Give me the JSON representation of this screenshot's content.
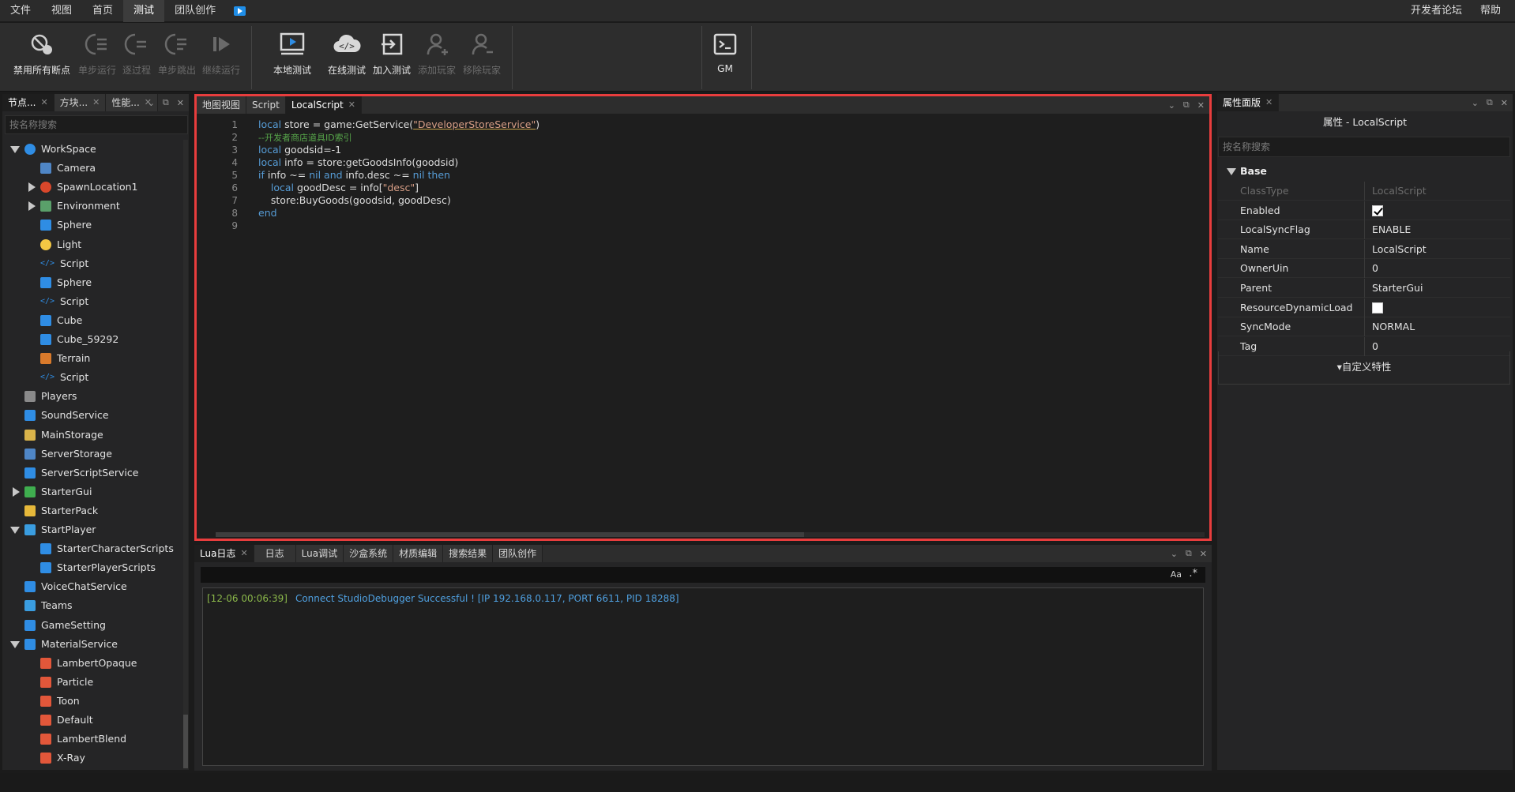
{
  "menu": {
    "items": [
      "文件",
      "视图",
      "首页",
      "测试",
      "团队创作"
    ],
    "active": "测试",
    "right": [
      "开发者论坛",
      "帮助"
    ]
  },
  "toolbar": {
    "disable_breakpoints": "禁用所有断点",
    "step_run": "单步运行",
    "step_over": "逐过程",
    "step_out": "单步跳出",
    "continue_run": "继续运行",
    "local_test": "本地测试",
    "online_test": "在线测试",
    "join_test": "加入测试",
    "add_player": "添加玩家",
    "remove_player": "移除玩家",
    "gm": "GM"
  },
  "explorer": {
    "tabs": [
      "节点...",
      "方块...",
      "性能..."
    ],
    "search_placeholder": "按名称搜索",
    "tree": [
      {
        "label": "WorkSpace",
        "depth": 0,
        "expand": "down",
        "color": "#2f8de4",
        "round": true
      },
      {
        "label": "Camera",
        "depth": 1,
        "expand": "",
        "color": "#4f86c6"
      },
      {
        "label": "SpawnLocation1",
        "depth": 1,
        "expand": "right",
        "color": "#d9472b",
        "round": true
      },
      {
        "label": "Environment",
        "depth": 1,
        "expand": "right",
        "color": "#5aa06a"
      },
      {
        "label": "Sphere",
        "depth": 1,
        "expand": "",
        "color": "#2f8de4"
      },
      {
        "label": "Light",
        "depth": 1,
        "expand": "",
        "color": "#f2c744",
        "round": true
      },
      {
        "label": "Script",
        "depth": 1,
        "expand": "",
        "color": "#2f8de4",
        "code": true
      },
      {
        "label": "Sphere",
        "depth": 1,
        "expand": "",
        "color": "#2f8de4"
      },
      {
        "label": "Script",
        "depth": 1,
        "expand": "",
        "color": "#2f8de4",
        "code": true
      },
      {
        "label": "Cube",
        "depth": 1,
        "expand": "",
        "color": "#2f8de4"
      },
      {
        "label": "Cube_59292",
        "depth": 1,
        "expand": "",
        "color": "#2f8de4"
      },
      {
        "label": "Terrain",
        "depth": 1,
        "expand": "",
        "color": "#d97a2b"
      },
      {
        "label": "Script",
        "depth": 1,
        "expand": "",
        "color": "#2f8de4",
        "code": true
      },
      {
        "label": "Players",
        "depth": 0,
        "expand": "",
        "color": "#8a8a8a"
      },
      {
        "label": "SoundService",
        "depth": 0,
        "expand": "",
        "color": "#2f8de4"
      },
      {
        "label": "MainStorage",
        "depth": 0,
        "expand": "",
        "color": "#d9b34a"
      },
      {
        "label": "ServerStorage",
        "depth": 0,
        "expand": "",
        "color": "#4f86c6"
      },
      {
        "label": "ServerScriptService",
        "depth": 0,
        "expand": "",
        "color": "#2f8de4"
      },
      {
        "label": "StarterGui",
        "depth": 0,
        "expand": "right",
        "color": "#3fae4f"
      },
      {
        "label": "StarterPack",
        "depth": 0,
        "expand": "",
        "color": "#e6b83a"
      },
      {
        "label": "StartPlayer",
        "depth": 0,
        "expand": "down",
        "color": "#3a9de0"
      },
      {
        "label": "StarterCharacterScripts",
        "depth": 1,
        "expand": "",
        "color": "#2f8de4"
      },
      {
        "label": "StarterPlayerScripts",
        "depth": 1,
        "expand": "",
        "color": "#2f8de4"
      },
      {
        "label": "VoiceChatService",
        "depth": 0,
        "expand": "",
        "color": "#2f8de4"
      },
      {
        "label": "Teams",
        "depth": 0,
        "expand": "",
        "color": "#3a9de0"
      },
      {
        "label": "GameSetting",
        "depth": 0,
        "expand": "",
        "color": "#2f8de4"
      },
      {
        "label": "MaterialService",
        "depth": 0,
        "expand": "down",
        "color": "#2f8de4"
      },
      {
        "label": "LambertOpaque",
        "depth": 1,
        "expand": "",
        "color": "#e2573a"
      },
      {
        "label": "Particle",
        "depth": 1,
        "expand": "",
        "color": "#e2573a"
      },
      {
        "label": "Toon",
        "depth": 1,
        "expand": "",
        "color": "#e2573a"
      },
      {
        "label": "Default",
        "depth": 1,
        "expand": "",
        "color": "#e2573a"
      },
      {
        "label": "LambertBlend",
        "depth": 1,
        "expand": "",
        "color": "#e2573a"
      },
      {
        "label": "X-Ray",
        "depth": 1,
        "expand": "",
        "color": "#e2573a"
      }
    ]
  },
  "editor": {
    "tabs": [
      "地图视图",
      "Script",
      "LocalScript"
    ],
    "active_tab": "LocalScript",
    "lines": [
      {
        "n": "1",
        "parts": [
          [
            "kw",
            "local "
          ],
          [
            "tx",
            "store = game:GetService("
          ],
          [
            "str",
            "\"DeveloperStoreService\""
          ],
          [
            "tx",
            ")"
          ]
        ]
      },
      {
        "n": "2",
        "parts": [
          [
            "cm",
            "--开发者商店道具ID索引"
          ]
        ]
      },
      {
        "n": "3",
        "parts": [
          [
            "kw",
            "local "
          ],
          [
            "tx",
            "goodsid=-1"
          ]
        ]
      },
      {
        "n": "4",
        "parts": [
          [
            "kw",
            "local "
          ],
          [
            "tx",
            "info = store:getGoodsInfo(goodsid)"
          ]
        ]
      },
      {
        "n": "5",
        "parts": [
          [
            "kw",
            "if "
          ],
          [
            "tx",
            "info ~= "
          ],
          [
            "kw",
            "nil and "
          ],
          [
            "tx",
            "info.desc ~= "
          ],
          [
            "kw",
            "nil then"
          ]
        ]
      },
      {
        "n": "6",
        "parts": [
          [
            "tx",
            "    "
          ],
          [
            "kw",
            "local "
          ],
          [
            "tx",
            "goodDesc = info["
          ],
          [
            "str2",
            "\"desc\""
          ],
          [
            "tx",
            "]"
          ]
        ]
      },
      {
        "n": "7",
        "parts": [
          [
            "tx",
            "    store:BuyGoods(goodsid, goodDesc)"
          ]
        ]
      },
      {
        "n": "8",
        "parts": [
          [
            "kw",
            "end"
          ]
        ]
      },
      {
        "n": "9",
        "parts": []
      }
    ]
  },
  "output": {
    "tabs": [
      "Lua日志",
      "日志",
      "Lua调试",
      "沙盒系统",
      "材质编辑",
      "搜索结果",
      "团队创作"
    ],
    "active_tab": "Lua日志",
    "aa": "Aa",
    "regex": ".*",
    "log": [
      {
        "ts": "[12-06 00:06:39]",
        "msg": "Connect StudioDebugger Successful ! [IP 192.168.0.117, PORT 6611, PID 18288]"
      }
    ]
  },
  "properties": {
    "tab": "属性面版",
    "title": "属性 - LocalScript",
    "search_placeholder": "按名称搜索",
    "section": "Base",
    "rows": [
      {
        "key": "ClassType",
        "value": "LocalScript",
        "dim": true
      },
      {
        "key": "Enabled",
        "checkbox": true,
        "checked": true
      },
      {
        "key": "LocalSyncFlag",
        "value": "ENABLE"
      },
      {
        "key": "Name",
        "value": "LocalScript"
      },
      {
        "key": "OwnerUin",
        "value": "0"
      },
      {
        "key": "Parent",
        "value": "StarterGui"
      },
      {
        "key": "ResourceDynamicLoad",
        "checkbox": true,
        "checked": false
      },
      {
        "key": "SyncMode",
        "value": "NORMAL"
      },
      {
        "key": "Tag",
        "value": "0"
      }
    ],
    "custom": "▾自定义特性"
  },
  "colors": {
    "accent": "#e83d3d",
    "keyword": "#569cd6",
    "string": "#d69d85",
    "comment": "#57a64a",
    "log": "#4fa0e0"
  }
}
